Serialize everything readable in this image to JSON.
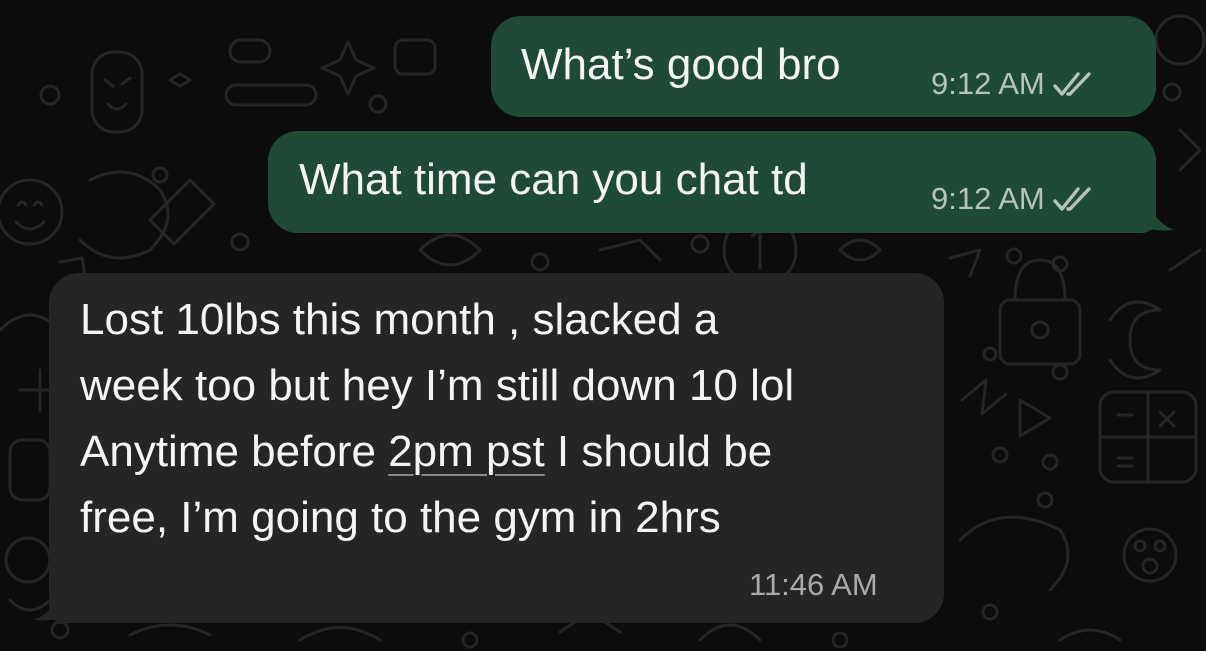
{
  "colors": {
    "background": "#0c0c0c",
    "outgoing_bubble": "#1f4a35",
    "incoming_bubble": "#242626",
    "text": "#f4f4f4",
    "timestamp": "#b7c4bb"
  },
  "messages": [
    {
      "direction": "outgoing",
      "text": "What’s good bro",
      "time": "9:12 AM",
      "status_icon": "double-check-icon"
    },
    {
      "direction": "outgoing",
      "text": "What time can you chat td",
      "time": "9:12 AM",
      "status_icon": "double-check-icon"
    },
    {
      "direction": "incoming",
      "lines": [
        "Lost 10lbs this month , slacked a",
        "week too but hey I’m still down 10 lol",
        "Anytime before ",
        "2pm pst",
        " I should be",
        "free, I’m going to the gym in 2hrs"
      ],
      "time": "11:46 AM"
    }
  ]
}
